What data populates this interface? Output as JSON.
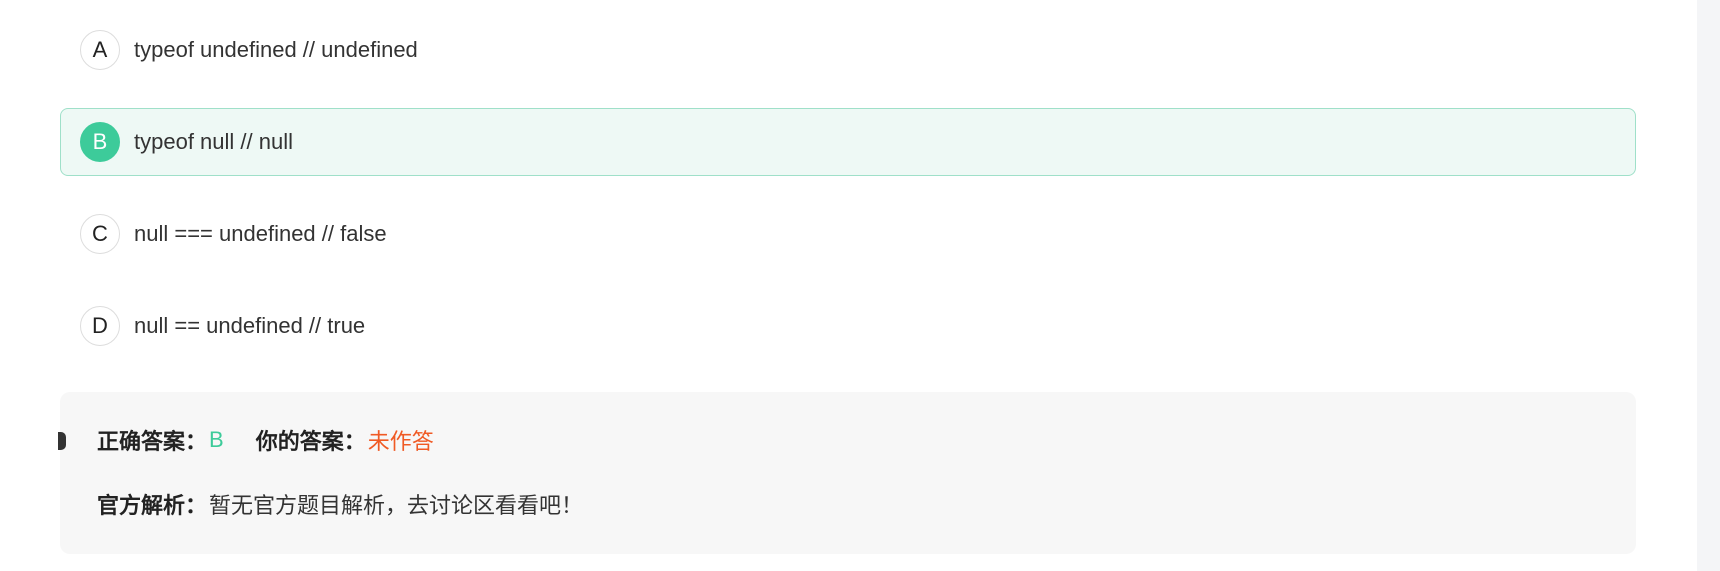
{
  "question": {
    "options": [
      {
        "letter": "A",
        "text": "typeof undefined // undefined",
        "selected": false
      },
      {
        "letter": "B",
        "text": "typeof null // null",
        "selected": true
      },
      {
        "letter": "C",
        "text": "null === undefined // false",
        "selected": false
      },
      {
        "letter": "D",
        "text": "null == undefined // true",
        "selected": false
      }
    ]
  },
  "answer": {
    "correct_label": "正确答案：",
    "correct_value": "B",
    "yours_label": "你的答案：",
    "yours_value": "未作答",
    "analysis_label": "官方解析：",
    "analysis_text": "暂无官方题目解析，去讨论区看看吧！"
  },
  "colors": {
    "accent_green": "#3dcb9a",
    "selected_bg": "#eef9f5",
    "warning_orange": "#f05a24",
    "panel_bg": "#f7f7f7"
  }
}
